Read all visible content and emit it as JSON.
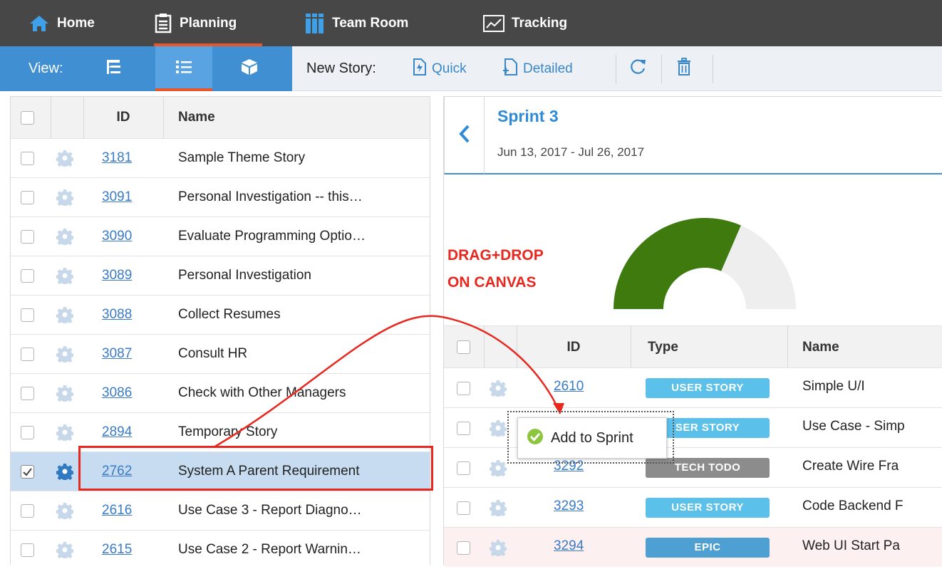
{
  "topnav": {
    "items": [
      {
        "label": "Home",
        "icon": "home-icon"
      },
      {
        "label": "Planning",
        "icon": "planning-icon"
      },
      {
        "label": "Team Room",
        "icon": "team-room-icon"
      },
      {
        "label": "Tracking",
        "icon": "tracking-icon"
      }
    ],
    "active": "Planning"
  },
  "toolbar": {
    "view_label": "View:",
    "view_buttons": [
      "tree-view-icon",
      "list-view-icon",
      "box-view-icon"
    ],
    "active_view": "list-view-icon",
    "new_story_label": "New Story:",
    "quick_label": "Quick",
    "detailed_label": "Detailed",
    "icons": [
      "refresh-icon",
      "trash-icon"
    ]
  },
  "backlog": {
    "columns": [
      "ID",
      "Name"
    ],
    "rows": [
      {
        "id": "3181",
        "name": "Sample Theme Story",
        "checked": false
      },
      {
        "id": "3091",
        "name": "Personal Investigation -- this…",
        "checked": false
      },
      {
        "id": "3090",
        "name": "Evaluate Programming Optio…",
        "checked": false
      },
      {
        "id": "3089",
        "name": "Personal Investigation",
        "checked": false
      },
      {
        "id": "3088",
        "name": "Collect Resumes",
        "checked": false
      },
      {
        "id": "3087",
        "name": "Consult HR",
        "checked": false
      },
      {
        "id": "3086",
        "name": "Check with Other Managers",
        "checked": false
      },
      {
        "id": "2894",
        "name": "Temporary Story",
        "checked": false
      },
      {
        "id": "2762",
        "name": "System A Parent Requirement",
        "checked": true
      },
      {
        "id": "2616",
        "name": "Use Case 3 - Report Diagno…",
        "checked": false
      },
      {
        "id": "2615",
        "name": "Use Case 2 - Report Warnin…",
        "checked": false
      }
    ]
  },
  "sprint": {
    "title": "Sprint 3",
    "dates": "Jun 13, 2017 - Jul 26, 2017",
    "progress_fraction": 0.63,
    "columns": [
      "ID",
      "Type",
      "Name"
    ],
    "rows": [
      {
        "id": "2610",
        "type": "USER STORY",
        "name": "Simple U/I"
      },
      {
        "id": "",
        "type": "SER STORY",
        "name": "Use Case - Simp"
      },
      {
        "id": "3292",
        "type": "TECH TODO",
        "name": "Create Wire Fra"
      },
      {
        "id": "3293",
        "type": "USER STORY",
        "name": "Code Backend F"
      },
      {
        "id": "3294",
        "type": "EPIC",
        "name": "Web UI Start Pa"
      }
    ]
  },
  "annotation": {
    "line1": "DRAG+DROP",
    "line2": "ON CANVAS",
    "color": "#e8281e"
  },
  "drop_tooltip": {
    "label": "Add to Sprint"
  },
  "colors": {
    "nav_bg": "#474747",
    "accent_orange": "#e8562a",
    "view_blue": "#3f8fd2",
    "link_blue": "#3a7bc8",
    "gauge_green": "#3f7a0e",
    "gauge_gray": "#eeeeee",
    "badge_user_story": "#5bc0ea",
    "badge_tech_todo": "#8c8c8c",
    "badge_epic": "#4fa0d2",
    "selected_row": "#c7dcf0",
    "epic_row": "#fdf0f0"
  }
}
